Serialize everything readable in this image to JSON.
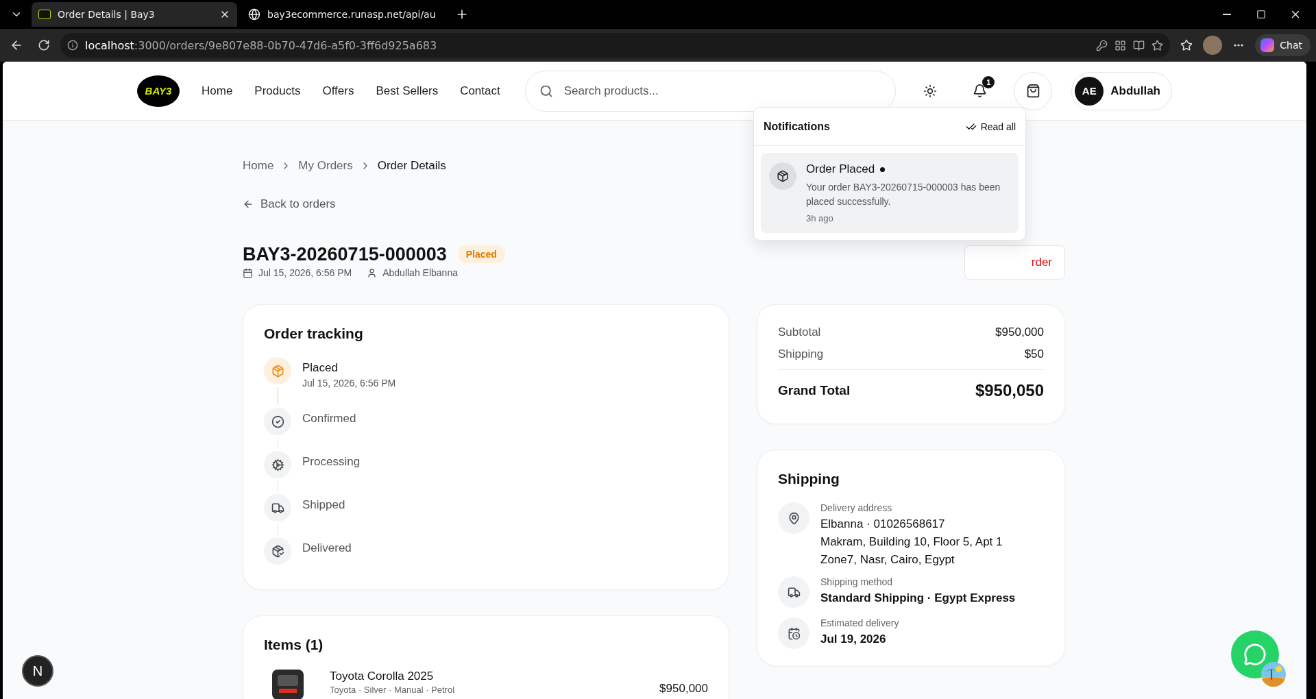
{
  "browser": {
    "tabs": [
      {
        "title": "Order Details | Bay3",
        "selected": true,
        "kind": "logo"
      },
      {
        "title": "bay3ecommerce.runasp.net/api/au",
        "selected": false,
        "kind": "globe"
      }
    ],
    "url_host": "localhost",
    "url_path": ":3000/orders/9e807e88-0b70-47d6-a5f0-3ff6d925a683",
    "chat_label": "Chat"
  },
  "header": {
    "logo": "BAY3",
    "nav": [
      "Home",
      "Products",
      "Offers",
      "Best Sellers",
      "Contact"
    ],
    "search_placeholder": "Search products...",
    "notification_count": "1",
    "user_initials": "AE",
    "user_name": "Abdullah"
  },
  "notifications": {
    "title": "Notifications",
    "read_all": "Read all",
    "items": [
      {
        "title": "Order Placed",
        "unread": true,
        "message": "Your order BAY3-20260715-000003 has been placed successfully.",
        "time": "3h ago"
      }
    ]
  },
  "breadcrumb": [
    {
      "label": "Home",
      "current": false
    },
    {
      "label": "My Orders",
      "current": false
    },
    {
      "label": "Order Details",
      "current": true
    }
  ],
  "back_link": "Back to orders",
  "order": {
    "number": "BAY3-20260715-000003",
    "status": "Placed",
    "date": "Jul 15, 2026, 6:56 PM",
    "customer": "Abdullah Elbanna",
    "cancel_label": "rder"
  },
  "tracking": {
    "title": "Order tracking",
    "steps": [
      {
        "label": "Placed",
        "time": "Jul 15, 2026, 6:56 PM",
        "done": true,
        "kind": "placed"
      },
      {
        "label": "Confirmed",
        "done": false,
        "kind": "confirmed"
      },
      {
        "label": "Processing",
        "done": false,
        "kind": "processing"
      },
      {
        "label": "Shipped",
        "done": false,
        "kind": "shipped"
      },
      {
        "label": "Delivered",
        "done": false,
        "kind": "delivered"
      }
    ]
  },
  "summary": {
    "rows": [
      {
        "label": "Subtotal",
        "value": "$950,000"
      },
      {
        "label": "Shipping",
        "value": "$50"
      }
    ],
    "total_label": "Grand Total",
    "total_value": "$950,050"
  },
  "shipping": {
    "title": "Shipping",
    "sections": [
      {
        "kind": "address",
        "label": "Delivery address",
        "lines": [
          "Elbanna · 01026568617",
          "Makram, Building 10, Floor 5, Apt 1",
          "Zone7, Nasr, Cairo, Egypt"
        ]
      },
      {
        "kind": "method",
        "label": "Shipping method",
        "lines": [
          "Standard Shipping · Egypt Express"
        ]
      },
      {
        "kind": "eta",
        "label": "Estimated delivery",
        "lines": [
          "Jul 19, 2026"
        ]
      }
    ]
  },
  "items": {
    "title": "Items (1)",
    "rows": [
      {
        "name": "Toyota Corolla 2025",
        "details": "Toyota · Silver · Manual · Petrol",
        "price": "$950,000"
      }
    ]
  },
  "dev_badge": "N"
}
